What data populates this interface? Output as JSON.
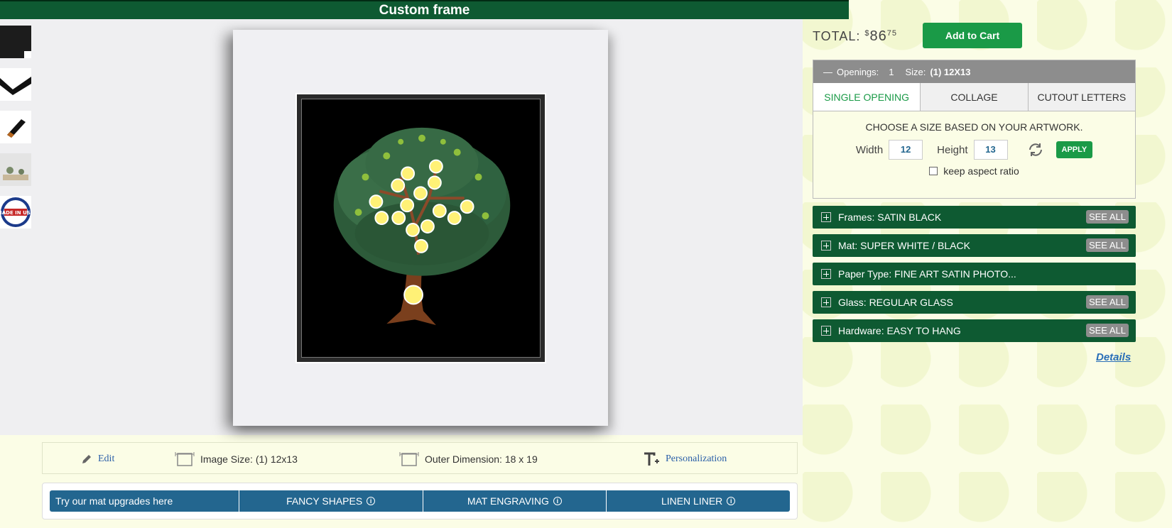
{
  "header": {
    "title": "Custom frame"
  },
  "thumbnails": [
    {
      "name": "frame-corner-thumb"
    },
    {
      "name": "frame-profile-thumb"
    },
    {
      "name": "frame-side-thumb"
    },
    {
      "name": "room-view-thumb"
    },
    {
      "name": "made-in-usa-thumb",
      "label": "MADE IN USA"
    }
  ],
  "info_bar": {
    "edit": "Edit",
    "image_size": "Image Size: (1) 12x13",
    "outer_dimension": "Outer Dimension: 18 x 19",
    "personalization": "Personalization"
  },
  "upgrades": {
    "intro": "Try our mat upgrades here",
    "items": [
      "FANCY SHAPES",
      "MAT ENGRAVING",
      "LINEN LINER"
    ]
  },
  "cart": {
    "total_label": "TOTAL:",
    "currency": "$",
    "dollars": "86",
    "cents": "75",
    "add_to_cart": "Add to Cart"
  },
  "openings": {
    "toggle": "—",
    "label": "Openings:",
    "count": "1",
    "size_label": "Size:",
    "size_value": "(1) 12X13",
    "tabs": [
      "SINGLE OPENING",
      "COLLAGE",
      "CUTOUT LETTERS"
    ],
    "active_tab": 0,
    "choose_text": "CHOOSE A SIZE BASED ON YOUR ARTWORK.",
    "width_label": "Width",
    "width_value": "12",
    "height_label": "Height",
    "height_value": "13",
    "apply": "APPLY",
    "aspect_label": "keep aspect ratio"
  },
  "options": [
    {
      "label": "Frames: SATIN BLACK",
      "see_all": "SEE ALL"
    },
    {
      "label": "Mat: SUPER WHITE / BLACK",
      "see_all": "SEE ALL"
    },
    {
      "label": "Paper Type: FINE ART SATIN PHOTO...",
      "see_all": ""
    },
    {
      "label": "Glass: REGULAR GLASS",
      "see_all": "SEE ALL"
    },
    {
      "label": "Hardware: EASY TO HANG",
      "see_all": "SEE ALL"
    }
  ],
  "details_link": "Details",
  "colors": {
    "brand_green": "#0e5a32",
    "cta_green": "#1a9a47",
    "upgrade_blue": "#23668f",
    "background": "#fbfde6"
  }
}
